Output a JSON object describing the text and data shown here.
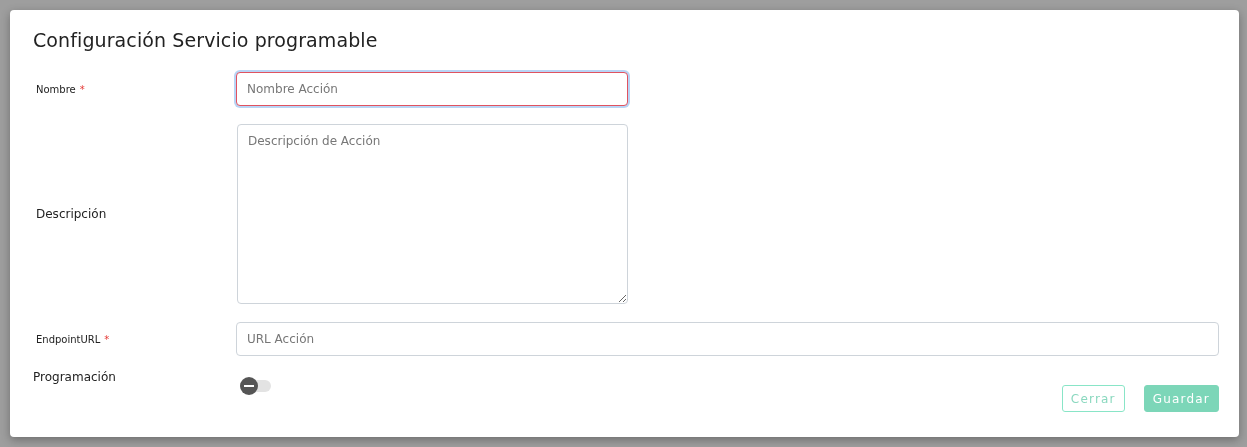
{
  "dialog": {
    "title": "Configuración Servicio programable",
    "fields": [
      {
        "kind": "input",
        "label": "Nombre",
        "required_mark": "*",
        "placeholder": "Nombre Acción",
        "focused": true,
        "invalid": true,
        "wide": false
      },
      {
        "kind": "textarea",
        "label": "Descripción",
        "placeholder": "Descripción de Acción",
        "focused": false,
        "invalid": false,
        "wide": false
      },
      {
        "kind": "input",
        "label": "EndpointURL",
        "required_mark": "*",
        "placeholder": "URL Acción",
        "focused": false,
        "invalid": false,
        "wide": true
      },
      {
        "kind": "toggle",
        "label": "Programación",
        "on": false
      }
    ],
    "buttons": [
      {
        "label": "Cerrar",
        "kind": "outline",
        "disabled": true
      },
      {
        "label": "Guardar",
        "kind": "primary",
        "disabled": true
      }
    ]
  }
}
